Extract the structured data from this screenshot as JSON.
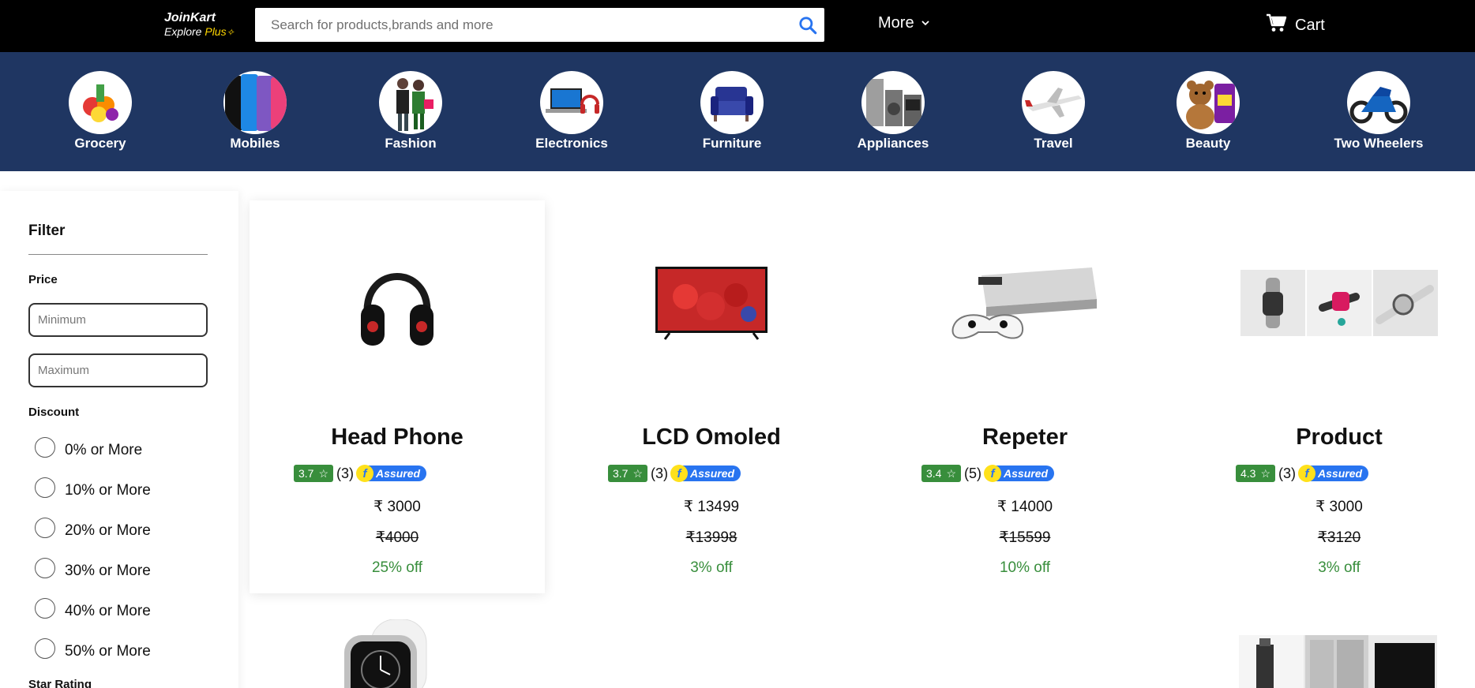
{
  "header": {
    "brand": "JoinKart",
    "tagline_prefix": "Explore ",
    "tagline_plus": "Plus",
    "search_placeholder": "Search for products,brands and more",
    "more_label": "More",
    "cart_label": "Cart",
    "icons": [
      "search-icon",
      "chevron-down-icon",
      "cart-icon"
    ]
  },
  "categories": [
    {
      "label": "Grocery"
    },
    {
      "label": "Mobiles"
    },
    {
      "label": "Fashion"
    },
    {
      "label": "Electronics"
    },
    {
      "label": "Furniture"
    },
    {
      "label": "Appliances"
    },
    {
      "label": "Travel"
    },
    {
      "label": "Beauty"
    },
    {
      "label": "Two Wheelers"
    }
  ],
  "filter": {
    "title": "Filter",
    "price_label": "Price",
    "min_placeholder": "Minimum",
    "max_placeholder": "Maximum",
    "discount_label": "Discount",
    "discount_options": [
      "0% or More",
      "10% or More",
      "20% or More",
      "30% or More",
      "40% or More",
      "50% or More"
    ],
    "star_rating_label": "Star Rating"
  },
  "products": [
    {
      "title": "Head Phone",
      "rating": "3.7",
      "count": "(3)",
      "assured": "Assured",
      "price": "₹ 3000",
      "mrp": "₹4000",
      "off": "25% off"
    },
    {
      "title": "LCD Omoled",
      "rating": "3.7",
      "count": "(3)",
      "assured": "Assured",
      "price": "₹ 13499",
      "mrp": "₹13998",
      "off": "3% off"
    },
    {
      "title": "Repeter",
      "rating": "3.4",
      "count": "(5)",
      "assured": "Assured",
      "price": "₹ 14000",
      "mrp": "₹15599",
      "off": "10% off"
    },
    {
      "title": "Product",
      "rating": "4.3",
      "count": "(3)",
      "assured": "Assured",
      "price": "₹ 3000",
      "mrp": "₹3120",
      "off": "3% off"
    }
  ],
  "colors": {
    "topbar": "#000000",
    "category_bar": "#1f3662",
    "rating_green": "#388e3c",
    "assured_blue": "#2874f0",
    "assured_yellow": "#ffe11b"
  }
}
